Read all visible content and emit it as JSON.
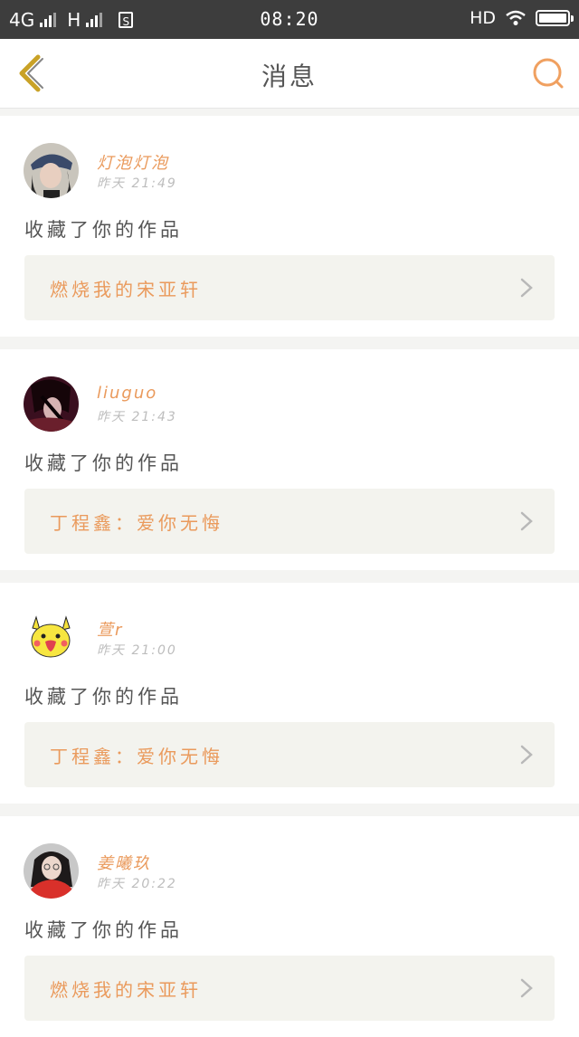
{
  "status_bar": {
    "network_1": "4G",
    "network_2": "H",
    "sim_label": "S",
    "time": "08:20",
    "hd": "HD"
  },
  "header": {
    "title": "消息",
    "back_icon": "chevron-left-icon",
    "search_icon": "search-icon"
  },
  "colors": {
    "accent": "#ea9a5c",
    "back_icon": "#c9a227",
    "search_icon": "#f0a060",
    "card_bg": "#ffffff",
    "work_bg": "#f3f3ee"
  },
  "messages": [
    {
      "username": "灯泡灯泡",
      "time": "昨天  21:49",
      "action": "收藏了你的作品",
      "work_title": "燃烧我的宋亚轩",
      "avatar": "avatar-girl-cap"
    },
    {
      "username": "liuguo",
      "time": "昨天  21:43",
      "action": "收藏了你的作品",
      "work_title": "丁程鑫：爱你无悔",
      "avatar": "avatar-anime-dark"
    },
    {
      "username": "萱r",
      "time": "昨天  21:00",
      "action": "收藏了你的作品",
      "work_title": "丁程鑫：爱你无悔",
      "avatar": "avatar-pikachu"
    },
    {
      "username": "姜曦玖",
      "time": "昨天  20:22",
      "action": "收藏了你的作品",
      "work_title": "燃烧我的宋亚轩",
      "avatar": "avatar-girl-red"
    }
  ]
}
